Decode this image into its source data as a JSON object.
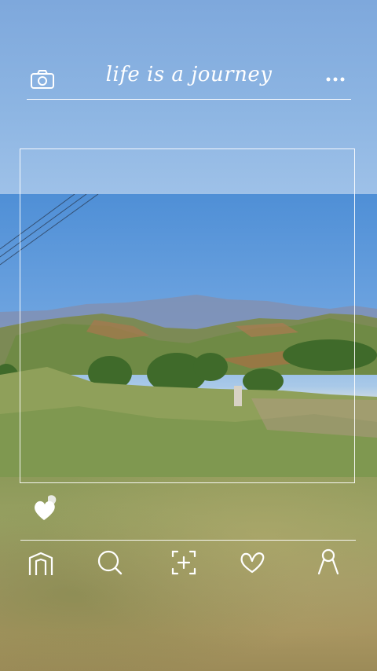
{
  "header": {
    "title": "life is a journey",
    "camera_icon": "camera-icon",
    "more_icon": "more-icon"
  },
  "like": {
    "icon": "heart-icon",
    "liked": true
  },
  "nav": {
    "items": [
      {
        "name": "home",
        "icon": "home-icon"
      },
      {
        "name": "search",
        "icon": "search-icon"
      },
      {
        "name": "add",
        "icon": "add-icon"
      },
      {
        "name": "likes",
        "icon": "heart-outline-icon"
      },
      {
        "name": "profile",
        "icon": "profile-icon"
      }
    ]
  },
  "colors": {
    "sky_top": "#7ea8dc",
    "line": "#ffffff",
    "hills": "#6f8a4a",
    "mountains": "#7d8fb5"
  }
}
